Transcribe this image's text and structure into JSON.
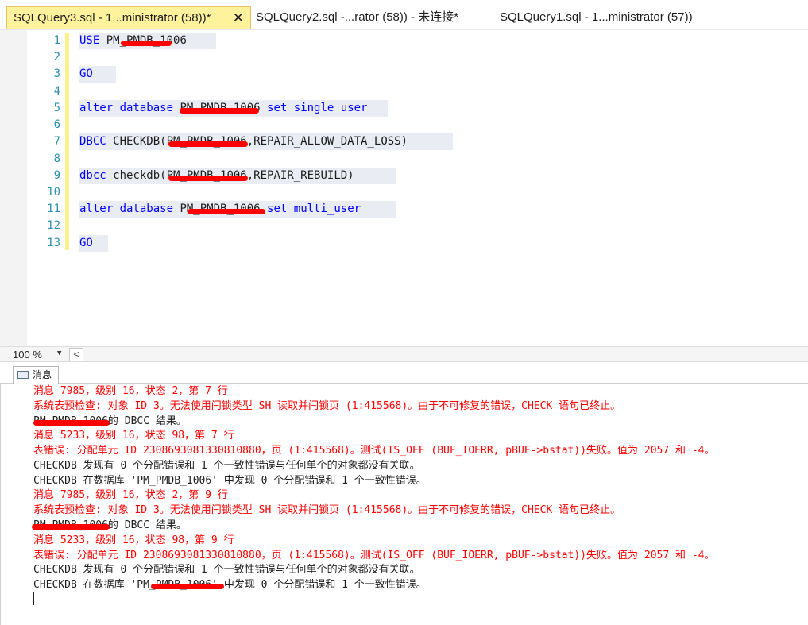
{
  "tabs": [
    {
      "label": "SQLQuery3.sql - 1...ministrator (58))*",
      "close": "✕"
    },
    {
      "label": "SQLQuery2.sql -...rator (58)) - 未连接*"
    },
    {
      "label": "SQLQuery1.sql - 1...ministrator (57))"
    }
  ],
  "editor": {
    "line_numbers": [
      "1",
      "2",
      "3",
      "4",
      "5",
      "6",
      "7",
      "8",
      "9",
      "10",
      "11",
      "12",
      "13"
    ],
    "lines": {
      "l1_kw": "USE",
      "l1_obj": "PM_PMDB_1006",
      "l3_kw": "GO",
      "l5_kw1": "alter database",
      "l5_obj": "PM_PMDB_1006",
      "l5_kw2": "set single_user",
      "l7_kw": "DBCC",
      "l7_fn": "CHECKDB(",
      "l7_obj": "PM_PMDB_1006",
      "l7_rest": ",REPAIR_ALLOW_DATA_LOSS)",
      "l9_kw": "dbcc",
      "l9_fn": "checkdb(",
      "l9_obj": "PM_PMDB_1006",
      "l9_rest": ",REPAIR_REBUILD)",
      "l11_kw1": "alter database",
      "l11_obj": "PM_PMDB_1006",
      "l11_kw2": "set multi_user",
      "l13_kw": "GO"
    }
  },
  "zoom": {
    "label": "100 %",
    "dropdown": "▼",
    "scroll_left": "<"
  },
  "messages_tab": {
    "label": "消息",
    "icon": "message-icon"
  },
  "messages": [
    {
      "type": "err",
      "text": "消息 7985，级别 16，状态 2，第 7 行"
    },
    {
      "type": "err",
      "text": "系统表预检查: 对象 ID 3。无法使用闩锁类型 SH 读取并闩锁页 (1:415568)。由于不可修复的错误，CHECK 语句已终止。"
    },
    {
      "type": "ok",
      "text": "PM_PMDB_1006的 DBCC 结果。"
    },
    {
      "type": "err",
      "text": "消息 5233，级别 16，状态 98，第 7 行"
    },
    {
      "type": "err",
      "text": "表错误: 分配单元 ID 2308693081330810880，页 (1:415568)。测试(IS_OFF (BUF_IOERR, pBUF->bstat))失败。值为 2057 和 -4。"
    },
    {
      "type": "ok",
      "text": "CHECKDB 发现有 0 个分配错误和 1 个一致性错误与任何单个的对象都没有关联。"
    },
    {
      "type": "ok",
      "text": "CHECKDB 在数据库 'PM_PMDB_1006' 中发现 0 个分配错误和 1 个一致性错误。"
    },
    {
      "type": "err",
      "text": "消息 7985，级别 16，状态 2，第 9 行"
    },
    {
      "type": "err",
      "text": "系统表预检查: 对象 ID 3。无法使用闩锁类型 SH 读取并闩锁页 (1:415568)。由于不可修复的错误，CHECK 语句已终止。"
    },
    {
      "type": "ok",
      "text": "PM_PMDB_1006的 DBCC 结果。"
    },
    {
      "type": "err",
      "text": "消息 5233，级别 16，状态 98，第 9 行"
    },
    {
      "type": "err",
      "text": "表错误: 分配单元 ID 2308693081330810880，页 (1:415568)。测试(IS_OFF (BUF_IOERR, pBUF->bstat))失败。值为 2057 和 -4。"
    },
    {
      "type": "ok",
      "text": "CHECKDB 发现有 0 个分配错误和 1 个一致性错误与任何单个的对象都没有关联。"
    },
    {
      "type": "ok",
      "text": "CHECKDB 在数据库 'PM_PMDB_1006' 中发现 0 个分配错误和 1 个一致性错误。"
    }
  ],
  "colors": {
    "keyword": "#0000ff",
    "error": "#ff0000",
    "line_number": "#2b91af",
    "active_tab": "#fff29d",
    "redaction": "#ff0000"
  }
}
